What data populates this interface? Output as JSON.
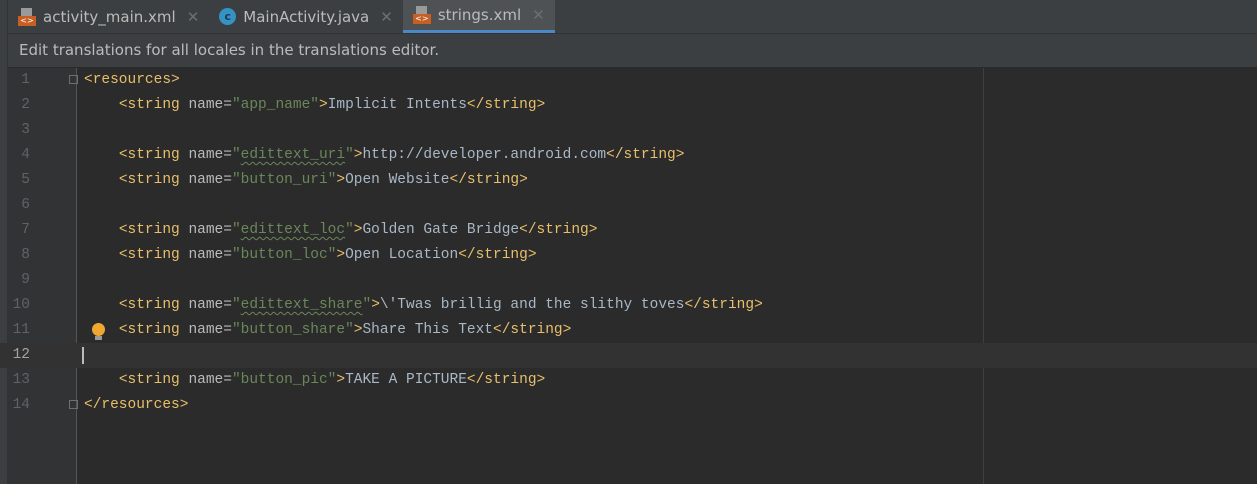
{
  "tabs": [
    {
      "label": "activity_main.xml",
      "icon": "xml-file-icon"
    },
    {
      "label": "MainActivity.java",
      "icon": "java-class-icon"
    },
    {
      "label": "strings.xml",
      "icon": "xml-file-icon",
      "active": true
    }
  ],
  "banner": "Edit translations for all locales in the translations editor.",
  "lines": [
    {
      "n": "1",
      "open": "<resources>"
    },
    {
      "n": "2",
      "name": "app_name",
      "text": "Implicit Intents"
    },
    {
      "n": "3"
    },
    {
      "n": "4",
      "name": "edittext_uri",
      "text": "http://developer.android.com"
    },
    {
      "n": "5",
      "name": "button_uri",
      "text": "Open Website"
    },
    {
      "n": "6"
    },
    {
      "n": "7",
      "name": "edittext_loc",
      "text": "Golden Gate Bridge"
    },
    {
      "n": "8",
      "name": "button_loc",
      "text": "Open Location"
    },
    {
      "n": "9"
    },
    {
      "n": "10",
      "name": "edittext_share",
      "text": "\\'Twas brillig and the slithy toves"
    },
    {
      "n": "11",
      "name": "button_share",
      "text": "Share This Text"
    },
    {
      "n": "12"
    },
    {
      "n": "13",
      "name": "button_pic",
      "text": "TAKE A PICTURE"
    },
    {
      "n": "14",
      "open": "</resources>"
    }
  ],
  "current_line": "12"
}
